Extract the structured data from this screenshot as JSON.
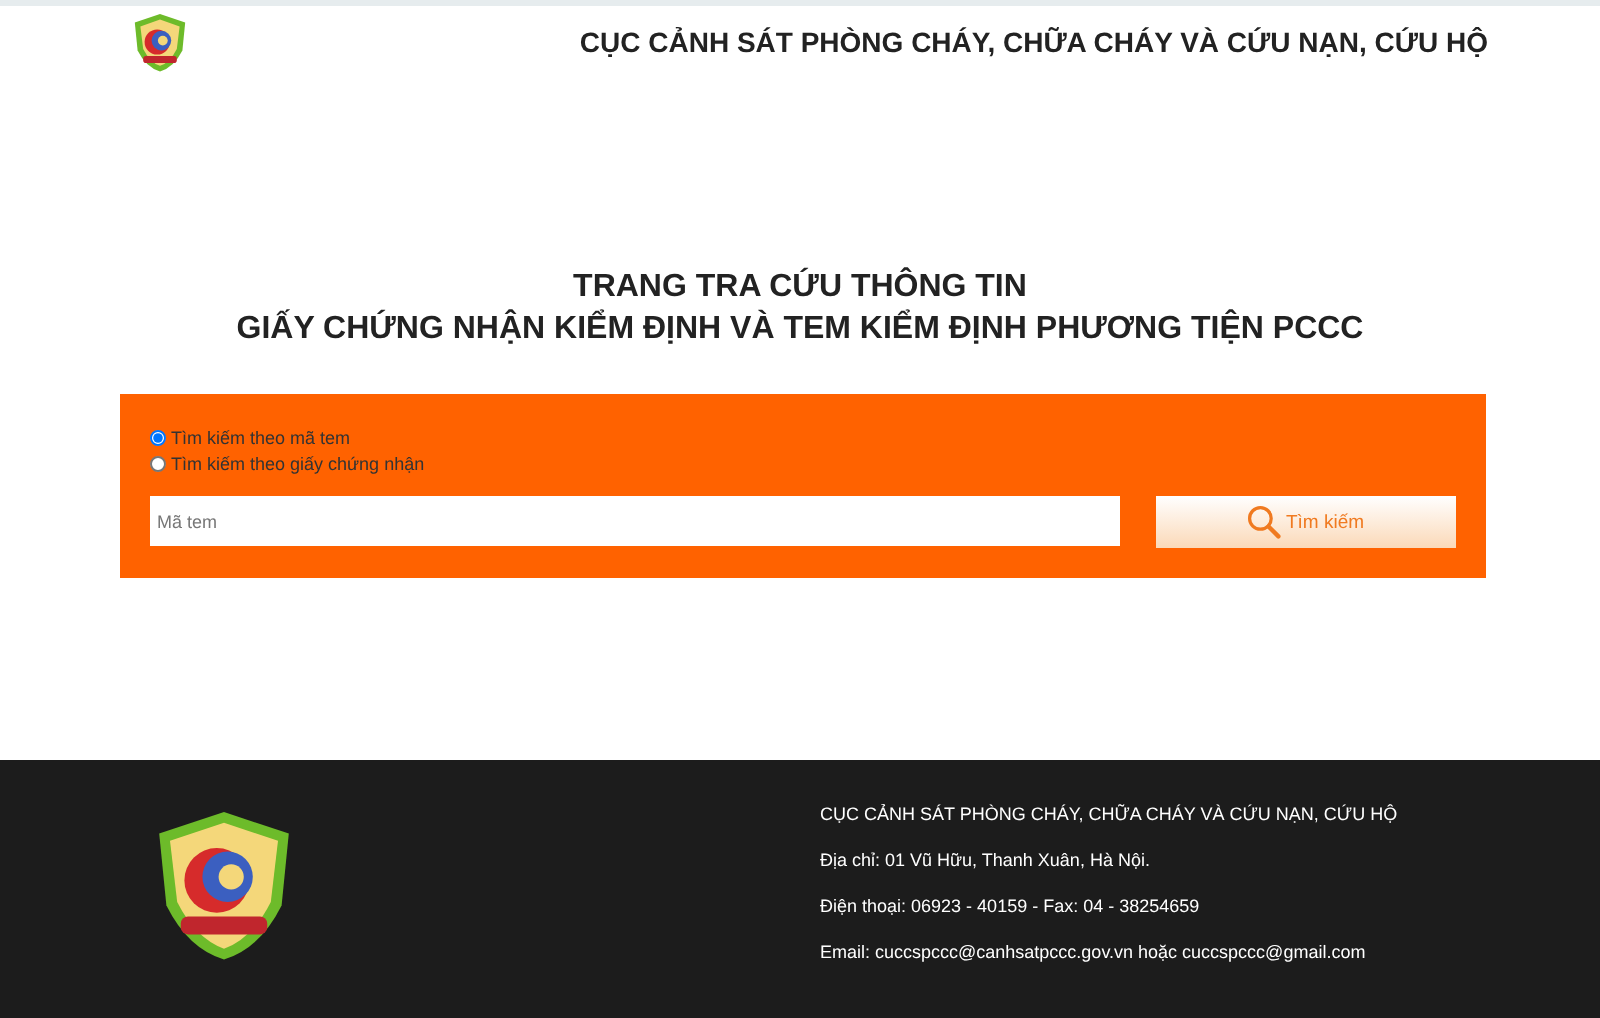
{
  "header": {
    "title": "CỤC CẢNH SÁT PHÒNG CHÁY, CHỮA CHÁY VÀ CỨU NẠN, CỨU HỘ"
  },
  "page_title": [
    "TRANG TRA CỨU THÔNG TIN",
    "GIẤY CHỨNG NHẬN KIỂM ĐỊNH VÀ TEM KIỂM ĐỊNH PHƯƠNG TIỆN PCCC"
  ],
  "search": {
    "options": [
      {
        "label": "Tìm kiếm theo mã tem",
        "selected": true
      },
      {
        "label": "Tìm kiếm theo giấy chứng nhận",
        "selected": false
      }
    ],
    "placeholder": "Mã tem",
    "button": "Tìm kiếm"
  },
  "footer": {
    "lines": [
      "CỤC CẢNH SÁT PHÒNG CHÁY, CHỮA CHÁY VÀ CỨU NẠN, CỨU HỘ",
      "Địa chỉ: 01 Vũ Hữu, Thanh Xuân, Hà Nội.",
      "Điện thoại: 06923 - 40159 - Fax: 04 - 38254659",
      "Email: cuccspccc@canhsatpccc.gov.vn hoặc cuccspccc@gmail.com"
    ]
  }
}
